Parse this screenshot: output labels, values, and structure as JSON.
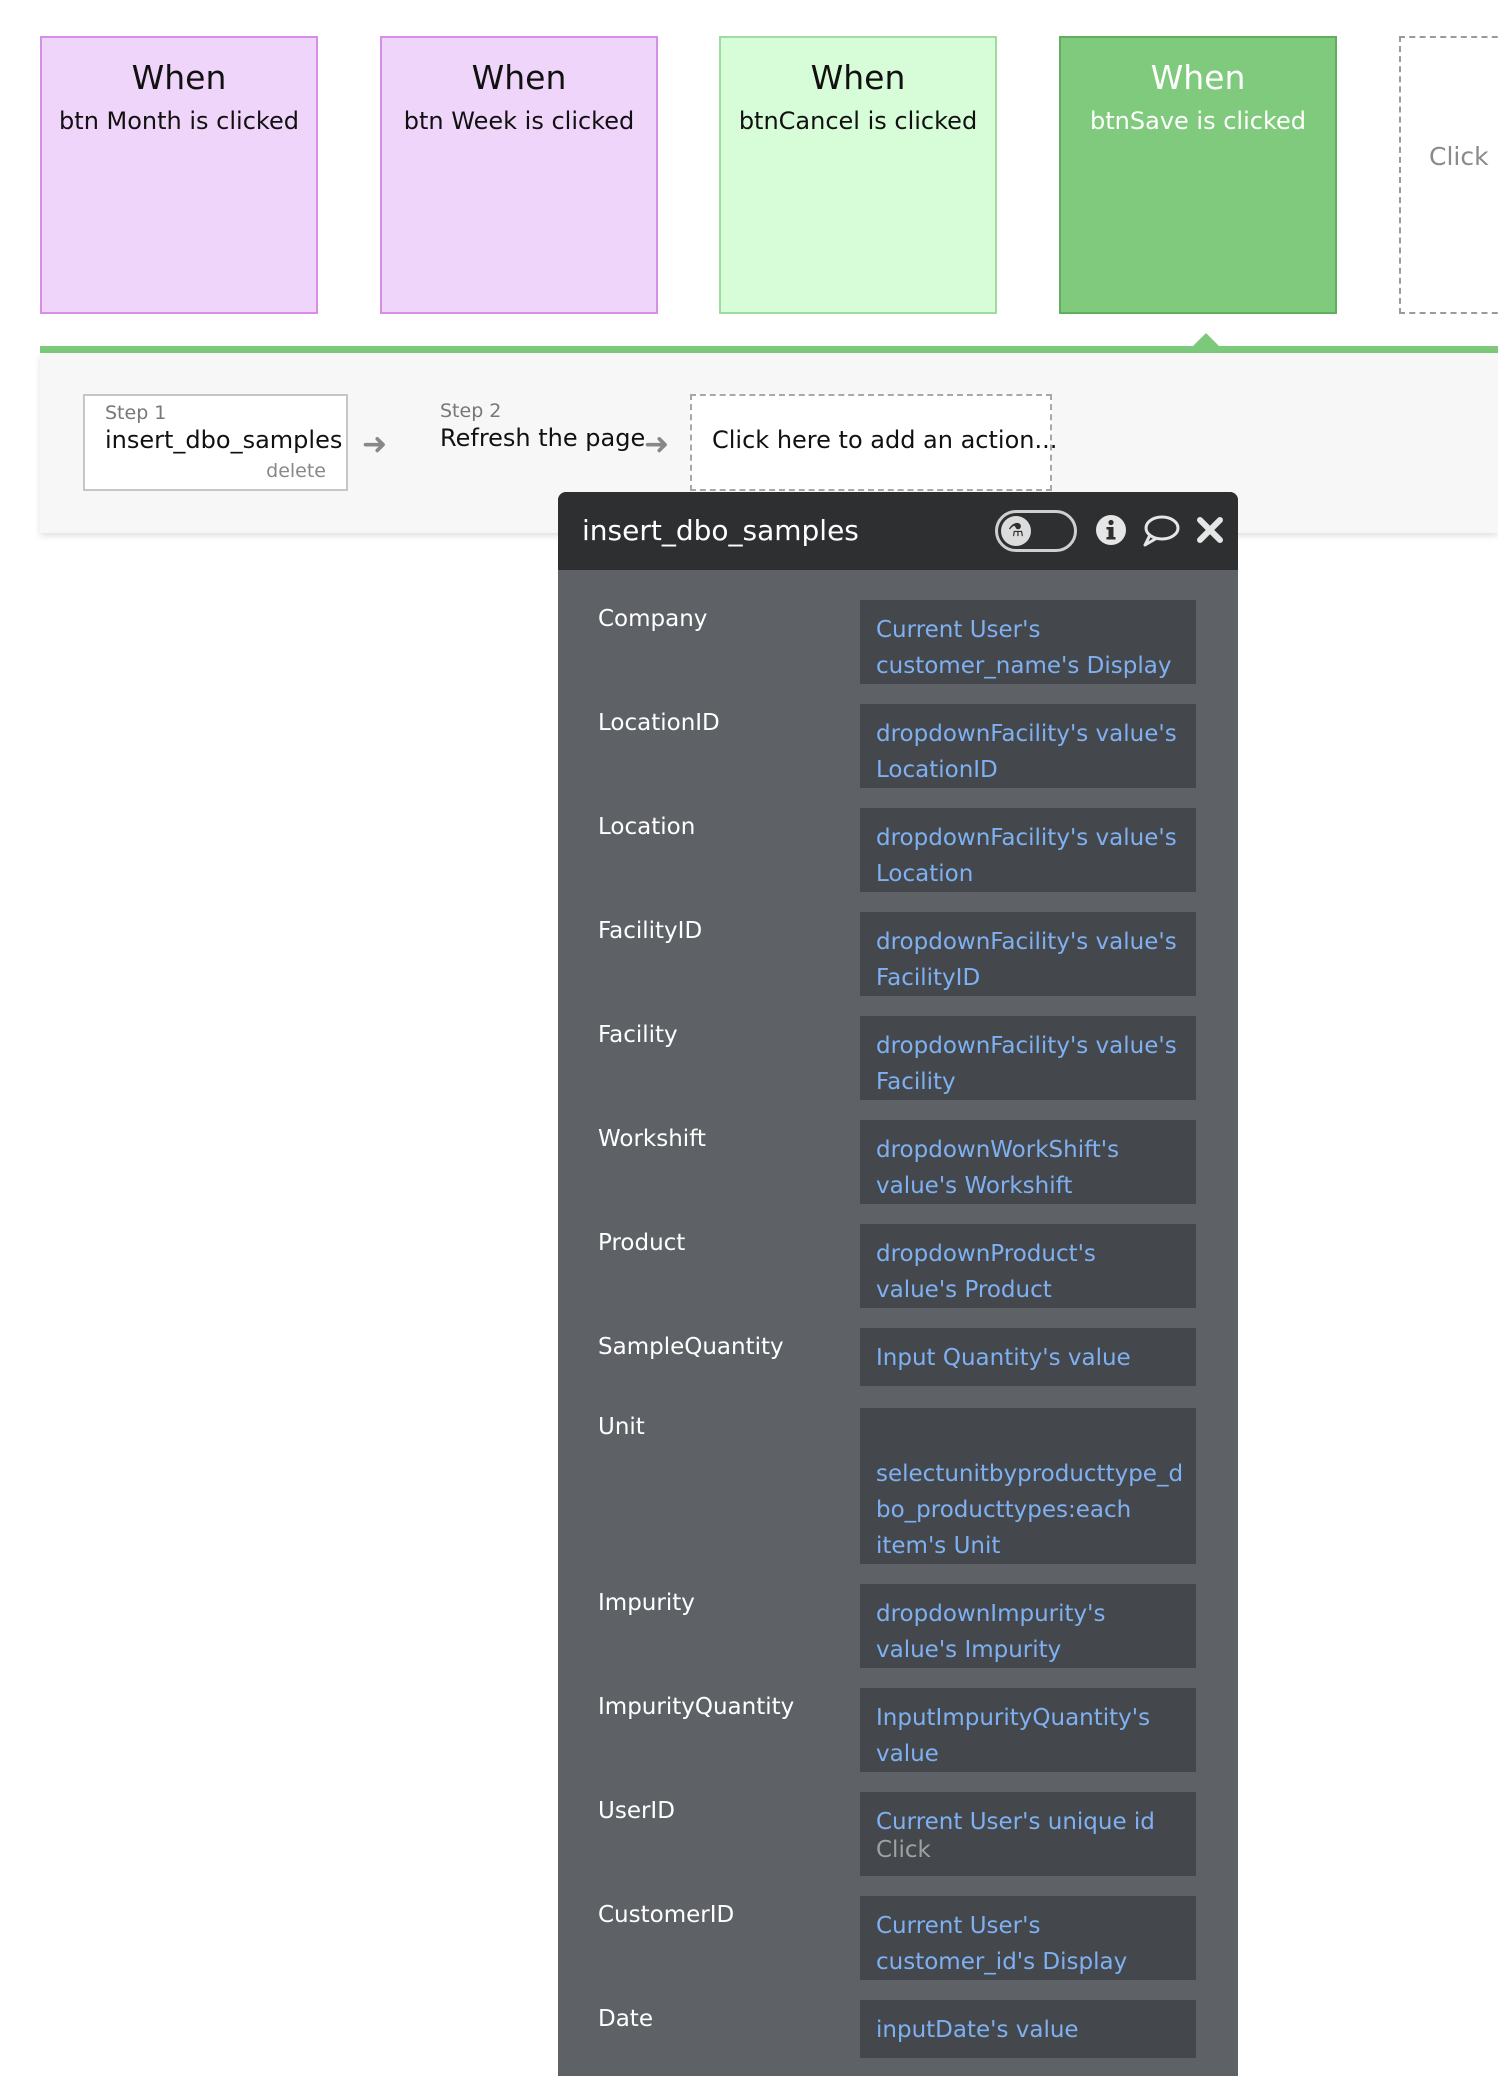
{
  "events": [
    {
      "when": "When",
      "condition": "btn Month is clicked",
      "color": "#f0d5fa"
    },
    {
      "when": "When",
      "condition": "btn Week is clicked",
      "color": "#f0d5fa"
    },
    {
      "when": "When",
      "condition": "btnCancel is clicked",
      "color": "#d7fcd8"
    },
    {
      "when": "When",
      "condition": "btnSave is clicked",
      "color": "#7fca7c"
    },
    {
      "add_label": "Click h"
    }
  ],
  "steps": [
    {
      "number": "Step 1",
      "name": "insert_dbo_samples",
      "delete_label": "delete"
    },
    {
      "number": "Step 2",
      "name": "Refresh the page"
    }
  ],
  "add_action_label": "Click here to add an action...",
  "editor": {
    "title": "insert_dbo_samples",
    "icons": [
      "flask-icon",
      "info-icon",
      "comment-icon",
      "close-icon"
    ],
    "fields": [
      {
        "label": "Company",
        "value": "Current User's\ncustomer_name's Display"
      },
      {
        "label": "LocationID",
        "value": "dropdownFacility's value's\nLocationID"
      },
      {
        "label": "Location",
        "value": "dropdownFacility's value's\nLocation"
      },
      {
        "label": "FacilityID",
        "value": "dropdownFacility's value's\nFacilityID"
      },
      {
        "label": "Facility",
        "value": "dropdownFacility's value's\nFacility"
      },
      {
        "label": "Workshift",
        "value": "dropdownWorkShift's\nvalue's Workshift"
      },
      {
        "label": "Product",
        "value": "dropdownProduct's\nvalue's Product"
      },
      {
        "label": "SampleQuantity",
        "value": "Input Quantity's value"
      },
      {
        "label": "Unit",
        "value": "\nselectunitbyproducttype_d\nbo_producttypes:each\nitem's Unit"
      },
      {
        "label": "Impurity",
        "value": "dropdownImpurity's\nvalue's Impurity"
      },
      {
        "label": "ImpurityQuantity",
        "value": "InputImpurityQuantity's\nvalue"
      },
      {
        "label": "UserID",
        "value": "Current User's unique id",
        "hint": "Click"
      },
      {
        "label": "CustomerID",
        "value": "Current User's\ncustomer_id's Display"
      },
      {
        "label": "Date",
        "value": "inputDate's value"
      }
    ]
  }
}
